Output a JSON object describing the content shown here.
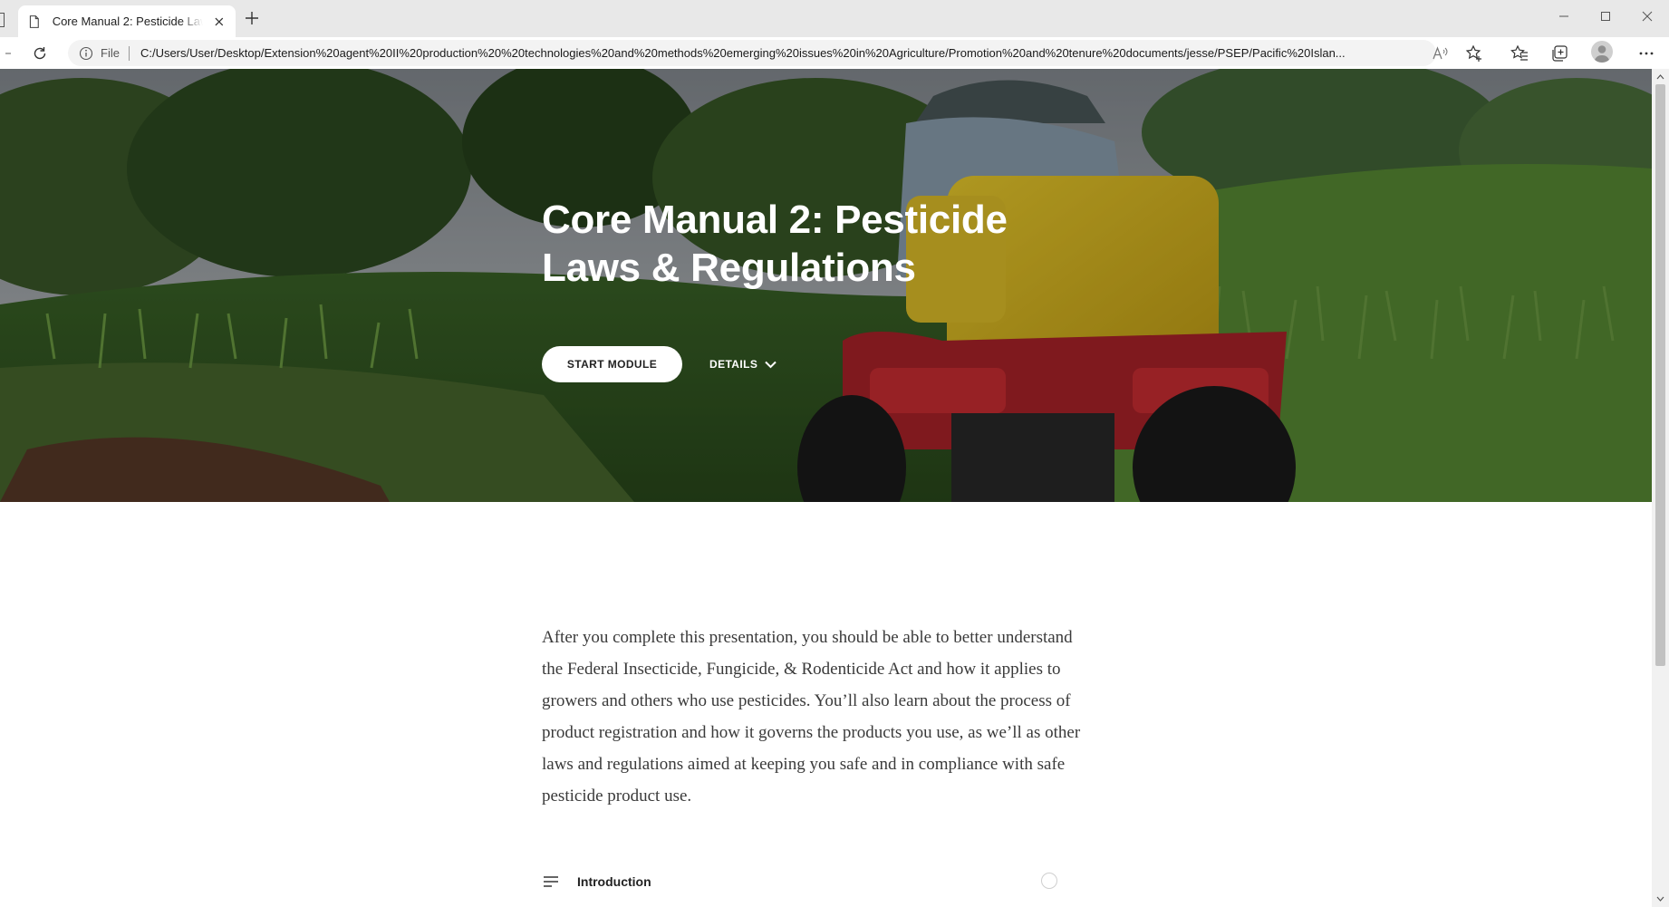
{
  "browser": {
    "tab_title": "Core Manual 2: Pesticide Laws & Regulations",
    "address_prefix": "File",
    "url": "C:/Users/User/Desktop/Extension%20agent%20II%20production%20%20technologies%20and%20methods%20emerging%20issues%20in%20Agriculture/Promotion%20and%20tenure%20documents/jesse/PSEP/Pacific%20Islan...",
    "icons": [
      "page-icon",
      "close-icon",
      "plus-icon",
      "minimize-icon",
      "maximize-icon",
      "close-window-icon",
      "refresh-icon",
      "info-icon",
      "read-aloud-icon",
      "add-favorite-icon",
      "favorites-icon",
      "collections-icon",
      "profile-icon",
      "more-icon"
    ]
  },
  "hero": {
    "title_line1": "Core Manual 2: Pesticide",
    "title_line2": "Laws & Regulations",
    "start_label": "START MODULE",
    "details_label": "DETAILS"
  },
  "content": {
    "intro": "After you complete this presentation, you should be able to better understand the Federal Insecticide, Fungicide, & Rodenticide Act and how it applies to growers and others who use pesticides.  You’ll also learn about the process of product registration and how it governs the products you use, as we’ll as other laws and regulations aimed at keeping you safe and in compliance with safe pesticide product use.",
    "lessons": [
      {
        "title": "Introduction",
        "icon": "list-icon",
        "status": "not-started"
      }
    ]
  },
  "colors": {
    "chrome_bg": "#e8e8e8",
    "address_bg": "#f3f3f3",
    "hero_overlay": "#000000",
    "body_text": "#3a3a3a"
  }
}
